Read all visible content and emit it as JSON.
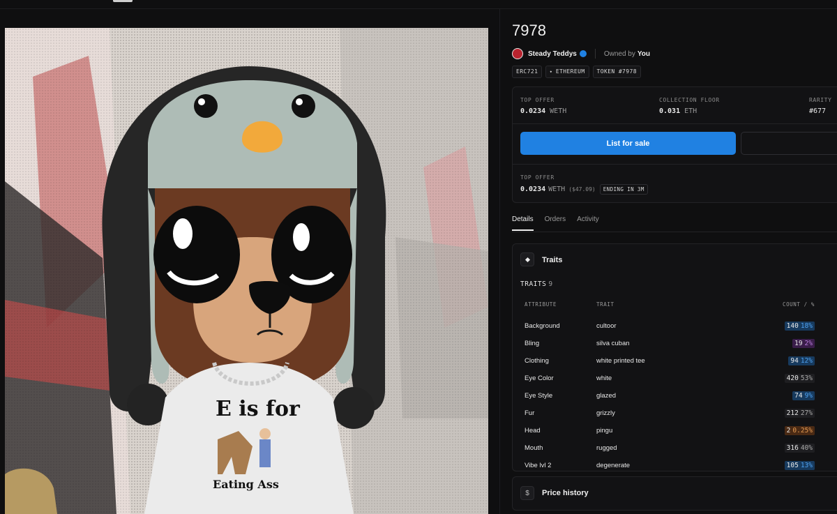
{
  "nft": {
    "title": "7978",
    "collection": "Steady Teddys",
    "owned_label": "Owned by",
    "owner": "You",
    "chips": [
      "ERC721",
      "ETHEREUM",
      "TOKEN #7978"
    ],
    "shirt_lines": [
      "E is for",
      "Eating Ass"
    ]
  },
  "stats": {
    "top_offer_label": "TOP OFFER",
    "top_offer_value": "0.0234",
    "top_offer_currency": "WETH",
    "floor_label": "COLLECTION FLOOR",
    "floor_value": "0.031",
    "floor_currency": "ETH",
    "rarity_label": "RARITY",
    "rarity_value": "#677"
  },
  "actions": {
    "list_label": "List for sale"
  },
  "offer": {
    "label": "TOP OFFER",
    "value": "0.0234",
    "currency": "WETH",
    "usd": "($47.09)",
    "ending": "ENDING IN 3M"
  },
  "tabs": [
    "Details",
    "Orders",
    "Activity"
  ],
  "traits": {
    "title": "Traits",
    "count_label": "TRAITS",
    "count": "9",
    "headers": {
      "attribute": "ATTRIBUTE",
      "trait": "TRAIT",
      "count": "COUNT / %"
    },
    "rows": [
      {
        "attribute": "Background",
        "trait": "cultoor",
        "count": "140",
        "pct": "18%",
        "bg": "#173a5e",
        "fg": "#4ea1f0"
      },
      {
        "attribute": "Bling",
        "trait": "silva cuban",
        "count": "19",
        "pct": "2%",
        "bg": "#3a1d4a",
        "fg": "#b97ddc"
      },
      {
        "attribute": "Clothing",
        "trait": "white printed tee",
        "count": "94",
        "pct": "12%",
        "bg": "#173a5e",
        "fg": "#4ea1f0"
      },
      {
        "attribute": "Eye Color",
        "trait": "white",
        "count": "420",
        "pct": "53%",
        "bg": "#1e1e21",
        "fg": "#a8a8a8"
      },
      {
        "attribute": "Eye Style",
        "trait": "glazed",
        "count": "74",
        "pct": "9%",
        "bg": "#173a5e",
        "fg": "#4ea1f0"
      },
      {
        "attribute": "Fur",
        "trait": "grizzly",
        "count": "212",
        "pct": "27%",
        "bg": "#1e1e21",
        "fg": "#a8a8a8"
      },
      {
        "attribute": "Head",
        "trait": "pingu",
        "count": "2",
        "pct": "0.25%",
        "bg": "#4a2a14",
        "fg": "#e39a52"
      },
      {
        "attribute": "Mouth",
        "trait": "rugged",
        "count": "316",
        "pct": "40%",
        "bg": "#1e1e21",
        "fg": "#a8a8a8"
      },
      {
        "attribute": "Vibe lvl 2",
        "trait": "degenerate",
        "count": "105",
        "pct": "13%",
        "bg": "#173a5e",
        "fg": "#4ea1f0"
      }
    ]
  },
  "price_history": {
    "title": "Price history"
  },
  "colors": {
    "accent": "#2081e2",
    "background": "#0f0f10"
  }
}
